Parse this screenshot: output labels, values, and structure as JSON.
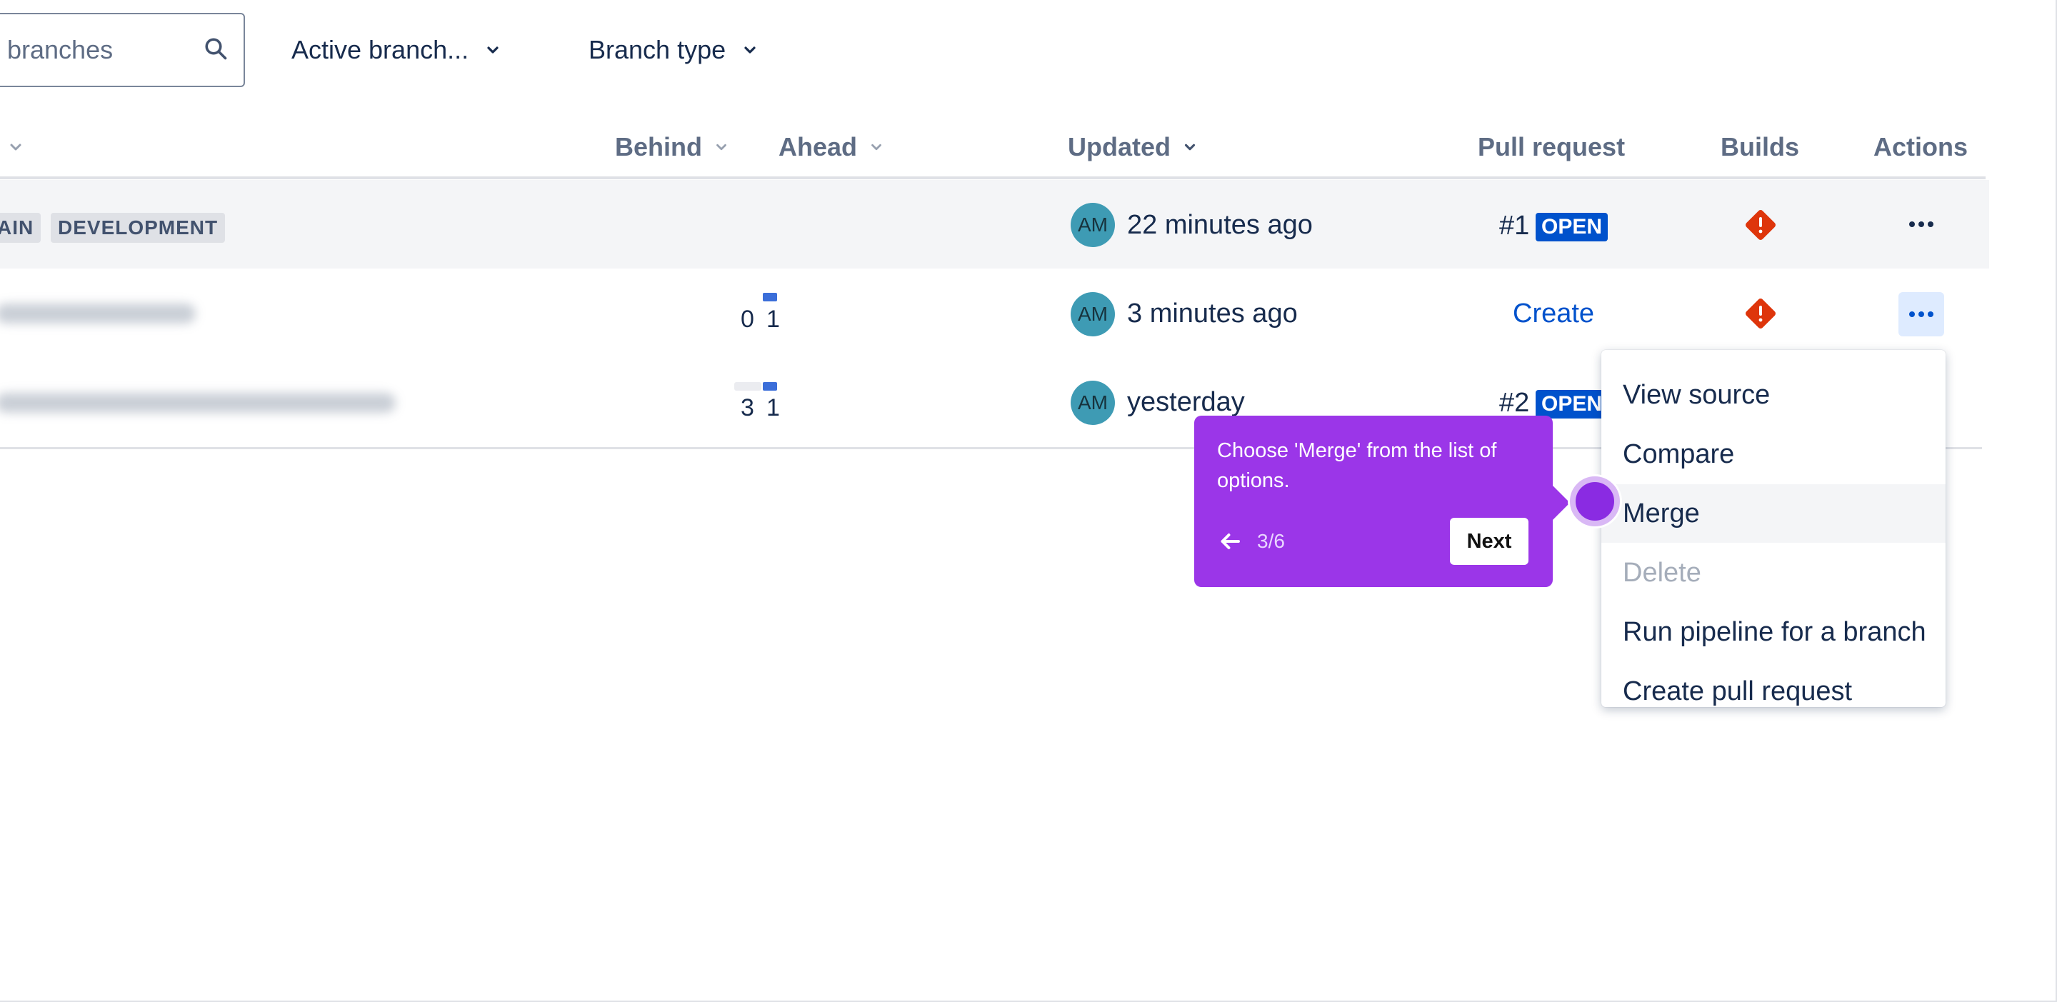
{
  "filters": {
    "search_placeholder": "branches",
    "status_filter": "Active branch...",
    "type_filter": "Branch type"
  },
  "table": {
    "columns": {
      "behind": "Behind",
      "ahead": "Ahead",
      "updated": "Updated",
      "pull_request": "Pull request",
      "builds": "Builds",
      "actions": "Actions"
    },
    "rows": [
      {
        "tags": [
          "AIN",
          "DEVELOPMENT"
        ],
        "avatar": "AM",
        "updated": "22 minutes ago",
        "pr_number": "#1",
        "pr_status": "OPEN",
        "actions_icon": "more-icon"
      },
      {
        "behind": "0",
        "ahead": "1",
        "avatar": "AM",
        "updated": "3 minutes ago",
        "pr_action": "Create",
        "actions_icon": "more-icon"
      },
      {
        "behind": "3",
        "ahead": "1",
        "avatar": "AM",
        "updated": "yesterday",
        "pr_number": "#2",
        "pr_status": "OPEN"
      }
    ]
  },
  "menu": {
    "items": [
      {
        "label": "View source"
      },
      {
        "label": "Compare"
      },
      {
        "label": "Merge"
      },
      {
        "label": "Delete"
      },
      {
        "label": "Run pipeline for a branch"
      },
      {
        "label": "Create pull request"
      }
    ]
  },
  "tooltip": {
    "text": "Choose 'Merge' from the list of options.",
    "step": "3/6",
    "next_label": "Next"
  },
  "colors": {
    "accent": "#0052cc",
    "tooltip_bg": "#9b36e8",
    "build_error": "#de350b",
    "avatar_bg": "#3e9bb4"
  }
}
